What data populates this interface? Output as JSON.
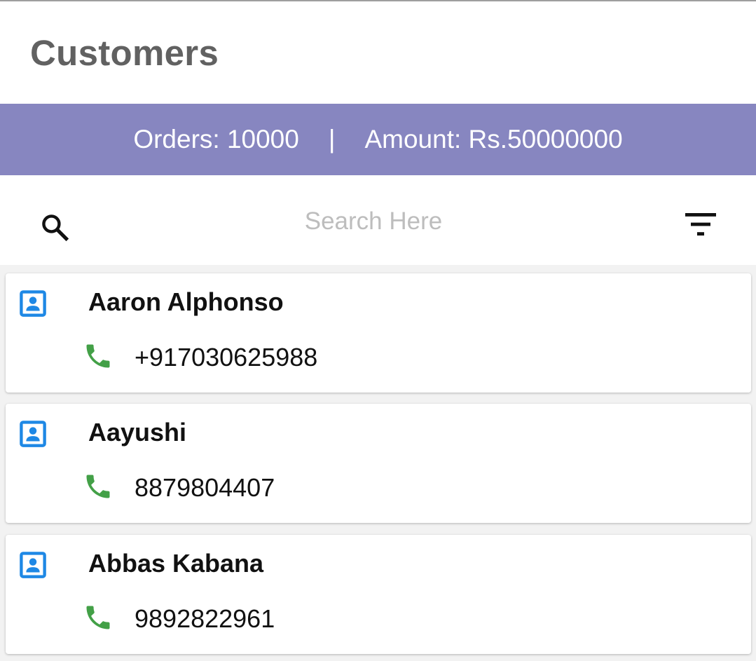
{
  "header": {
    "title": "Customers"
  },
  "stats": {
    "orders": "Orders: 10000",
    "separator": "|",
    "amount": "Amount: Rs.50000000",
    "bg_color": "#8786c0"
  },
  "search": {
    "placeholder": "Search Here",
    "value": ""
  },
  "icons": {
    "search": "search-icon",
    "filter": "filter-icon",
    "contact": "contact-icon",
    "phone": "phone-icon"
  },
  "colors": {
    "contact_icon": "#1e88e5",
    "phone_icon": "#43a047"
  },
  "customers": [
    {
      "name": "Aaron Alphonso",
      "phone": "+917030625988"
    },
    {
      "name": "Aayushi",
      "phone": "8879804407"
    },
    {
      "name": "Abbas Kabana",
      "phone": "9892822961"
    }
  ]
}
